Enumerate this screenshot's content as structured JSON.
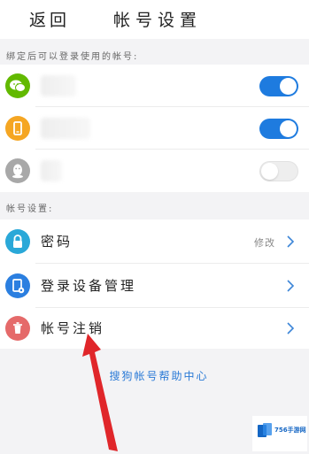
{
  "header": {
    "back_label": "返回",
    "title": "帐号设置"
  },
  "bound_section": {
    "label": "绑定后可以登录使用的帐号:",
    "accounts": [
      {
        "icon": "wechat-icon",
        "color": "#62b900",
        "toggle": "on"
      },
      {
        "icon": "phone-icon",
        "color": "#f5a623",
        "toggle": "on"
      },
      {
        "icon": "qq-icon",
        "color": "#a8a8a8",
        "toggle": "off"
      }
    ]
  },
  "account_section": {
    "label": "帐号设置:",
    "items": [
      {
        "label": "密码",
        "value": "修改",
        "icon": "lock-icon",
        "color": "#2aa8d8"
      },
      {
        "label": "登录设备管理",
        "value": "",
        "icon": "device-settings-icon",
        "color": "#2b7fe0"
      },
      {
        "label": "帐号注销",
        "value": "",
        "icon": "trash-icon",
        "color": "#e56a6a"
      }
    ]
  },
  "help_link": "搜狗帐号帮助中心",
  "watermark": {
    "text": "756手游网"
  },
  "colors": {
    "accent": "#1e7bdf",
    "arrow": "#e0262a"
  }
}
